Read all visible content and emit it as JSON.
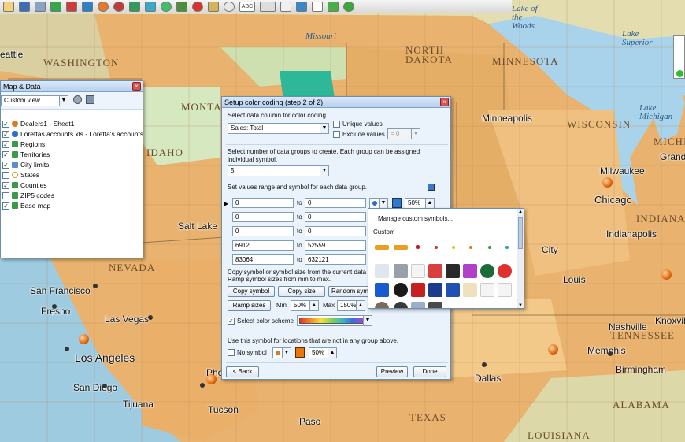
{
  "map": {
    "state_labels": [
      "WASHINGTON",
      "NORTH DAKOTA",
      "MINNESOTA",
      "WISCONSIN",
      "IDAHO",
      "NEVADA",
      "MICHIGAN",
      "INDIANA",
      "TENNESSEE",
      "ALABAMA",
      "TEXAS",
      "LOUISIANA",
      "MONTANA"
    ],
    "water_labels": [
      "Lake of the Woods",
      "Lake Superior",
      "Lake Michigan",
      "Missouri"
    ],
    "cities": [
      "eattle",
      "Minneapolis",
      "Milwaukee",
      "Grand Rapid",
      "Chicago",
      "Indianapolis",
      "Salt Lake",
      "San Francisco",
      "Fresno",
      "Las Vegas",
      "Los Angeles",
      "San Diego",
      "Tijuana",
      "Tucson",
      "Phoenix",
      "Dallas",
      "Memphis",
      "Nashville",
      "Birmingham",
      "Knoxville",
      "Paso",
      "City",
      "Louis"
    ]
  },
  "toolbar": {
    "abc_label": "ABC"
  },
  "map_data_panel": {
    "title": "Map & Data",
    "view_select": "Custom view",
    "layers": [
      {
        "label": "Dealers1 - Sheet1",
        "checked": true,
        "icon": "orange-dot-icon"
      },
      {
        "label": "Lorettas accounts xls - Loretta's accounts",
        "checked": true,
        "icon": "blue-dot-icon"
      },
      {
        "label": "Regions",
        "checked": true,
        "icon": "region-icon"
      },
      {
        "label": "Territories",
        "checked": true,
        "icon": "territory-icon"
      },
      {
        "label": "City limits",
        "checked": true,
        "icon": "city-limits-icon"
      },
      {
        "label": "States",
        "checked": false,
        "icon": "states-icon"
      },
      {
        "label": "Counties",
        "checked": true,
        "icon": "counties-icon"
      },
      {
        "label": "ZIP5 codes",
        "checked": false,
        "icon": "zip-icon"
      },
      {
        "label": "Base map",
        "checked": true,
        "icon": "basemap-icon"
      }
    ]
  },
  "dialog": {
    "title": "Setup color coding (step 2 of 2)",
    "select_column_label": "Select data column for color coding.",
    "column_value": "Sales: Total",
    "unique_values_label": "Unique values",
    "exclude_values_label": "Exclude values",
    "exclude_value": "= 0",
    "groups_label": "Select number of data groups to create. Each group can be assigned individual symbol.",
    "groups_value": "5",
    "range_label": "Set values range and symbol for each data group.",
    "ranges": [
      {
        "from": "0",
        "to": "0"
      },
      {
        "from": "0",
        "to": "0"
      },
      {
        "from": "0",
        "to": "0"
      },
      {
        "from": "6912",
        "to": "52559"
      },
      {
        "from": "83064",
        "to": "632121"
      }
    ],
    "to_label": "to",
    "size_pct": "50%",
    "copy_hint": "Copy symbol or symbol size from the current data g",
    "ramp_hint": "Ramp symbol sizes from min to max.",
    "copy_symbol_btn": "Copy symbol",
    "copy_size_btn": "Copy size",
    "random_symbol_btn": "Random sym",
    "ramp_sizes_btn": "Ramp sizes",
    "min_label": "Min",
    "min_value": "50%",
    "max_label": "Max",
    "max_value": "150%",
    "color_scheme_label": "Select color scheme",
    "color_scheme_checked": true,
    "not_in_group_label": "Use this symbol for locations that are not in any group above.",
    "no_symbol_label": "No symbol",
    "no_symbol_size": "50%",
    "back_btn": "< Back",
    "preview_btn": "Preview",
    "done_btn": "Done"
  },
  "symbol_popup": {
    "manage_label": "Manage custom symbols...",
    "custom_label": "Custom"
  },
  "colors": {
    "accent": "#4a7fc1",
    "scheme": [
      "#e53030",
      "#f08a24",
      "#f6e03a",
      "#8bd14b",
      "#3fb8c9",
      "#3b6fd8",
      "#9a4fc9"
    ]
  }
}
